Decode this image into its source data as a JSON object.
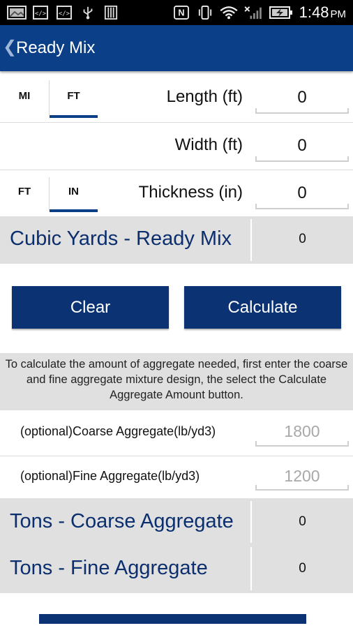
{
  "status_bar": {
    "time": "1:48",
    "ampm": "PM",
    "icons": [
      "gallery-icon",
      "code-icon",
      "code-icon",
      "usb-icon",
      "sd-card-icon",
      "nfc-icon",
      "vibrate-icon",
      "wifi-icon",
      "no-signal-icon",
      "battery-charging-icon"
    ]
  },
  "app_bar": {
    "title": "Ready Mix",
    "back_icon": "chevron-left-icon"
  },
  "length": {
    "units": [
      "MI",
      "FT"
    ],
    "selected_unit": "FT",
    "label": "Length (ft)",
    "value": "0"
  },
  "width": {
    "label": "Width (ft)",
    "value": "0"
  },
  "thickness": {
    "units": [
      "FT",
      "IN"
    ],
    "selected_unit": "IN",
    "label": "Thickness (in)",
    "value": "0"
  },
  "cubic_yards": {
    "label": "Cubic Yards - Ready Mix",
    "value": "0"
  },
  "buttons": {
    "clear": "Clear",
    "calculate": "Calculate"
  },
  "instructions": "To calculate the amount of aggregate needed, first enter the coarse and fine aggregate mixture design, the select the Calculate Aggregate Amount button.",
  "coarse_aggregate": {
    "label": "(optional)Coarse Aggregate(lb/yd3)",
    "placeholder": "1800"
  },
  "fine_aggregate": {
    "label": "(optional)Fine Aggregate(lb/yd3)",
    "placeholder": "1200"
  },
  "tons_coarse": {
    "label": "Tons - Coarse Aggregate",
    "value": "0"
  },
  "tons_fine": {
    "label": "Tons - Fine Aggregate",
    "value": "0"
  },
  "colors": {
    "primary": "#0b3f87",
    "button": "#0b3373",
    "result_text": "#0b2f6e",
    "band": "#e0e0e0"
  }
}
